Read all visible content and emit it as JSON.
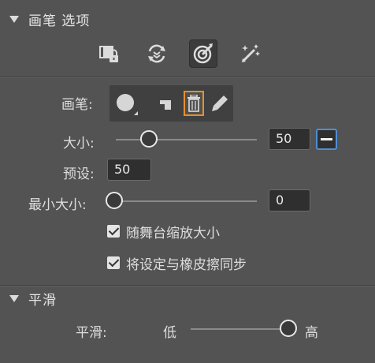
{
  "brush_options": {
    "title": "画笔 选项",
    "tools": [
      {
        "name": "lock-fill-icon"
      },
      {
        "name": "lock-rotation-icon"
      },
      {
        "name": "target-brush-icon",
        "active": true
      },
      {
        "name": "magic-pen-icon"
      }
    ],
    "brush_label": "画笔:",
    "size": {
      "label": "大小:",
      "value": "50",
      "slider_fraction": 0.2
    },
    "preset": {
      "label": "预设:",
      "value": "50"
    },
    "min_size": {
      "label": "最小大小:",
      "value": "0",
      "slider_fraction": 0.0
    },
    "scale_with_stage": {
      "label": "随舞台缩放大小",
      "checked": true
    },
    "sync_eraser": {
      "label": "将设定与橡皮擦同步",
      "checked": true
    }
  },
  "smoothing": {
    "title": "平滑",
    "label": "平滑:",
    "low_label": "低",
    "high_label": "高",
    "slider_fraction": 1.0
  },
  "colors": {
    "panel_bg": "#535353",
    "field_bg": "#2f2f2f",
    "highlight_orange": "#e8902a",
    "focus_blue": "#4d8fd6"
  }
}
